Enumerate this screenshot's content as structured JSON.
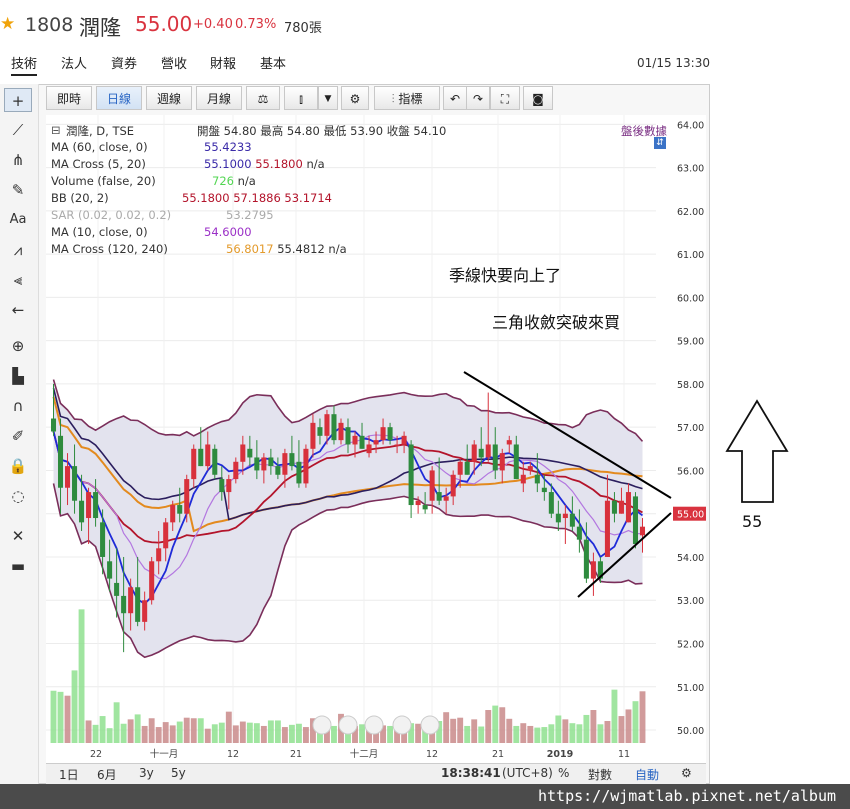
{
  "header": {
    "code": "1808",
    "name": "潤隆",
    "price": "55.00",
    "change": "+0.40",
    "change_pct": "0.73%",
    "volume": "780張"
  },
  "tabs": [
    "技術",
    "法人",
    "資券",
    "營收",
    "財報",
    "基本"
  ],
  "datetime": "01/15 13:30",
  "toolbar": {
    "intraday": "即時",
    "daily": "日線",
    "weekly": "週線",
    "monthly": "月線",
    "indicators": "指標"
  },
  "indicators": [
    {
      "label": "潤隆, D, TSE",
      "values": "開盤 54.80 最高 54.80 最低 53.90 收盤 54.10"
    },
    {
      "label": "MA (60, close, 0)",
      "v1": "55.4233"
    },
    {
      "label": "MA Cross (5, 20)",
      "v1": "55.1000",
      "v2": "55.1800",
      "v3": "n/a"
    },
    {
      "label": "Volume (false, 20)",
      "v1": "726",
      "v2": "n/a"
    },
    {
      "label": "BB (20, 2)",
      "v1": "55.1800",
      "v2": "57.1886",
      "v3": "53.1714"
    },
    {
      "label": "SAR (0.02, 0.02, 0.2)",
      "v1": "53.2795"
    },
    {
      "label": "MA (10, close, 0)",
      "v1": "54.6000"
    },
    {
      "label": "MA Cross (120, 240)",
      "v1": "56.8017",
      "v2": "55.4812",
      "v3": "n/a"
    }
  ],
  "after_hours": "盤後數據",
  "annotations": {
    "line1": "季線快要向上了",
    "line2": "三角收斂突破來買",
    "target": "55"
  },
  "price_axis": [
    "64.00",
    "63.00",
    "62.00",
    "61.00",
    "60.00",
    "59.00",
    "58.00",
    "57.00",
    "56.00",
    "55.00",
    "54.00",
    "53.00",
    "52.00",
    "51.00",
    "50.00"
  ],
  "last_price_tag": "55.00",
  "time_axis": [
    "22",
    "十一月",
    "12",
    "21",
    "十二月",
    "12",
    "21",
    "2019",
    "11"
  ],
  "bottom": {
    "r1": "1日",
    "r2": "6月",
    "r3": "3y",
    "r4": "5y",
    "clock": "18:38:41",
    "tz": "(UTC+8)",
    "pct": "%",
    "log": "對數",
    "auto": "自動"
  },
  "watermark": "https://wjmatlab.pixnet.net/album",
  "chart_data": {
    "type": "candlestick",
    "ylim": [
      49.7,
      64.1
    ],
    "candles": [
      [
        57.2,
        58.0,
        56.8,
        56.9
      ],
      [
        56.8,
        57.2,
        55.0,
        55.6
      ],
      [
        55.6,
        56.4,
        55.2,
        56.1
      ],
      [
        56.1,
        56.6,
        55.0,
        55.3
      ],
      [
        55.3,
        55.9,
        54.6,
        54.8
      ],
      [
        54.9,
        55.6,
        54.3,
        55.5
      ],
      [
        55.5,
        55.8,
        54.7,
        54.9
      ],
      [
        54.8,
        55.1,
        53.6,
        54.0
      ],
      [
        53.9,
        54.4,
        53.2,
        53.5
      ],
      [
        53.4,
        54.2,
        52.6,
        53.1
      ],
      [
        53.1,
        54.0,
        51.8,
        52.7
      ],
      [
        52.7,
        53.5,
        52.3,
        53.3
      ],
      [
        53.3,
        54.0,
        52.4,
        52.5
      ],
      [
        52.5,
        53.2,
        52.3,
        53.0
      ],
      [
        53.0,
        54.0,
        52.9,
        53.9
      ],
      [
        53.9,
        54.6,
        53.6,
        54.2
      ],
      [
        54.2,
        54.9,
        53.9,
        54.8
      ],
      [
        54.8,
        55.3,
        54.6,
        55.2
      ],
      [
        55.2,
        55.6,
        54.8,
        55.0
      ],
      [
        55.0,
        55.9,
        54.8,
        55.8
      ],
      [
        55.8,
        56.6,
        55.6,
        56.5
      ],
      [
        56.5,
        57.0,
        56.1,
        56.1
      ],
      [
        56.1,
        56.9,
        56.0,
        56.6
      ],
      [
        56.5,
        56.6,
        55.8,
        55.9
      ],
      [
        55.8,
        56.1,
        55.3,
        55.5
      ],
      [
        55.5,
        55.9,
        55.1,
        55.8
      ],
      [
        55.8,
        56.3,
        55.7,
        56.2
      ],
      [
        56.2,
        56.8,
        55.9,
        56.6
      ],
      [
        56.5,
        56.8,
        56.1,
        56.3
      ],
      [
        56.3,
        56.7,
        55.8,
        56.0
      ],
      [
        56.0,
        56.4,
        55.7,
        56.3
      ],
      [
        56.3,
        56.5,
        55.9,
        56.1
      ],
      [
        56.1,
        56.3,
        55.8,
        55.9
      ],
      [
        55.9,
        56.5,
        55.6,
        56.4
      ],
      [
        56.4,
        56.8,
        56.0,
        56.1
      ],
      [
        56.2,
        56.7,
        55.6,
        55.7
      ],
      [
        55.7,
        56.6,
        55.6,
        56.5
      ],
      [
        56.5,
        57.3,
        56.3,
        57.1
      ],
      [
        57.0,
        57.2,
        56.6,
        56.8
      ],
      [
        56.8,
        57.4,
        56.6,
        57.3
      ],
      [
        57.3,
        57.5,
        56.6,
        56.7
      ],
      [
        56.7,
        57.2,
        56.6,
        57.1
      ],
      [
        57.0,
        57.2,
        56.4,
        56.6
      ],
      [
        56.6,
        56.9,
        56.3,
        56.8
      ],
      [
        56.8,
        57.1,
        56.5,
        56.5
      ],
      [
        56.4,
        56.8,
        56.3,
        56.6
      ],
      [
        56.6,
        56.9,
        56.4,
        56.7
      ],
      [
        56.7,
        57.2,
        56.6,
        57.0
      ],
      [
        57.0,
        57.1,
        56.6,
        56.7
      ],
      [
        56.6,
        56.8,
        56.4,
        56.6
      ],
      [
        56.6,
        56.9,
        56.4,
        56.8
      ],
      [
        56.6,
        56.7,
        54.9,
        55.2
      ],
      [
        55.2,
        55.4,
        55.0,
        55.3
      ],
      [
        55.2,
        55.5,
        55.0,
        55.1
      ],
      [
        55.3,
        56.1,
        55.0,
        56.0
      ],
      [
        55.5,
        56.3,
        55.2,
        55.3
      ],
      [
        55.3,
        55.6,
        55.0,
        55.4
      ],
      [
        55.4,
        56.0,
        55.2,
        55.9
      ],
      [
        55.9,
        56.3,
        55.6,
        56.2
      ],
      [
        56.2,
        56.6,
        55.9,
        55.9
      ],
      [
        56.2,
        56.7,
        55.9,
        56.6
      ],
      [
        56.5,
        57.0,
        56.1,
        56.3
      ],
      [
        56.3,
        57.8,
        56.2,
        56.6
      ],
      [
        56.6,
        57.0,
        55.8,
        56.0
      ],
      [
        56.0,
        56.5,
        55.7,
        56.4
      ],
      [
        56.6,
        56.8,
        56.4,
        56.7
      ],
      [
        56.6,
        56.8,
        55.8,
        55.8
      ],
      [
        55.7,
        56.2,
        55.5,
        55.9
      ],
      [
        56.0,
        56.2,
        55.9,
        56.1
      ],
      [
        55.9,
        56.4,
        55.5,
        55.7
      ],
      [
        55.6,
        55.9,
        55.3,
        55.5
      ],
      [
        55.5,
        55.7,
        54.9,
        55.0
      ],
      [
        55.0,
        55.3,
        54.6,
        54.8
      ],
      [
        54.9,
        55.2,
        54.3,
        55.0
      ],
      [
        55.0,
        55.4,
        54.6,
        54.7
      ],
      [
        54.7,
        55.1,
        54.1,
        54.4
      ],
      [
        54.4,
        54.8,
        53.4,
        53.5
      ],
      [
        53.5,
        54.1,
        53.1,
        53.9
      ],
      [
        53.9,
        54.0,
        53.4,
        53.5
      ],
      [
        54.0,
        55.9,
        54.0,
        55.3
      ],
      [
        55.3,
        55.5,
        54.8,
        55.0
      ],
      [
        55.0,
        55.6,
        55.0,
        55.3
      ],
      [
        54.8,
        55.7,
        54.8,
        55.5
      ],
      [
        55.4,
        55.5,
        54.2,
        54.3
      ],
      [
        54.5,
        54.9,
        54.1,
        54.7
      ]
    ],
    "volumes": [
      9.5,
      9.3,
      8.6,
      13.2,
      24.3,
      4.1,
      3.3,
      4.9,
      2.7,
      7.4,
      3.5,
      4.3,
      5.2,
      3.1,
      4.5,
      2.9,
      3.8,
      3.2,
      3.9,
      4.6,
      4.5,
      4.5,
      2.6,
      3.4,
      3.7,
      5.7,
      3.2,
      3.9,
      3.7,
      3.6,
      3.1,
      4.1,
      4.1,
      2.9,
      3.3,
      3.5,
      2.9,
      4.5,
      3.2,
      3.7,
      3.1,
      5.3,
      4.1,
      3.1,
      3.4,
      2.9,
      2.9,
      3.2,
      3.1,
      3.4,
      4.4,
      3.6,
      3.5,
      3.8,
      2.9,
      4.0,
      5.6,
      4.4,
      4.6,
      3.1,
      4.3,
      3.0,
      6.0,
      6.8,
      6.5,
      4.4,
      3.1,
      3.6,
      3.1,
      2.8,
      2.9,
      3.4,
      5.0,
      4.3,
      3.6,
      3.4,
      5.1,
      6.0,
      3.4,
      4.0,
      9.7,
      4.9,
      6.1,
      7.6,
      9.4
    ]
  }
}
